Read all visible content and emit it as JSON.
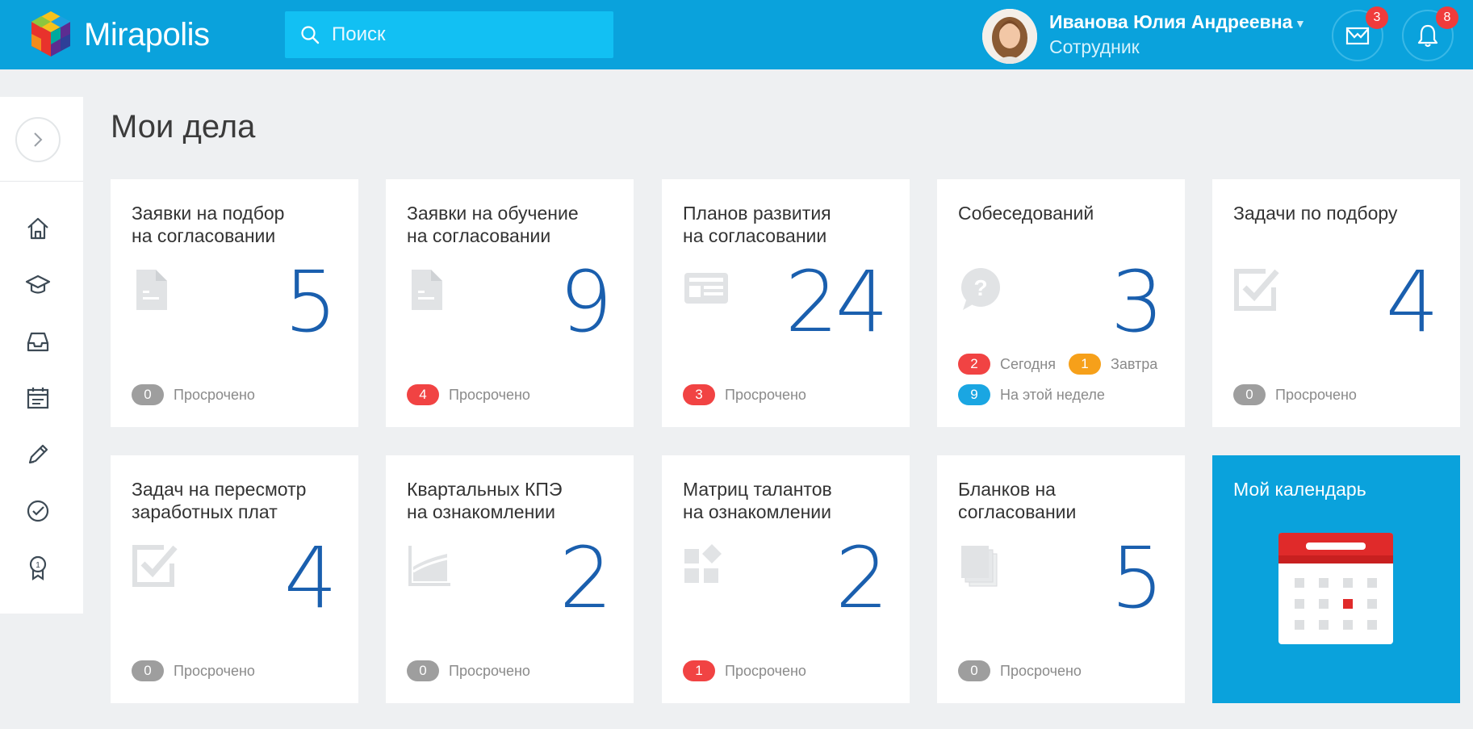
{
  "app": {
    "name": "Mirapolis"
  },
  "search": {
    "placeholder": "Поиск"
  },
  "user": {
    "name": "Иванова Юлия Андреевна",
    "role": "Сотрудник"
  },
  "header_buttons": {
    "messages_count": "3",
    "notifications_count": "8"
  },
  "sidebar": {
    "items": [
      {
        "icon": "home-icon"
      },
      {
        "icon": "graduation-cap-icon"
      },
      {
        "icon": "inbox-icon"
      },
      {
        "icon": "calendar-icon"
      },
      {
        "icon": "pencil-icon"
      },
      {
        "icon": "check-circle-icon"
      },
      {
        "icon": "award-icon"
      }
    ]
  },
  "page": {
    "title": "Мои дела"
  },
  "cards": [
    {
      "title_line1": "Заявки на подбор",
      "title_line2": "на согласовании",
      "count": "5",
      "overdue_count": "0",
      "overdue_label": "Просрочено",
      "icon": "document-icon"
    },
    {
      "title_line1": "Заявки на обучение",
      "title_line2": "на согласовании",
      "count": "9",
      "overdue_count": "4",
      "overdue_label": "Просрочено",
      "icon": "document-icon"
    },
    {
      "title_line1": "Планов развития",
      "title_line2": "на согласовании",
      "count": "24",
      "overdue_count": "3",
      "overdue_label": "Просрочено",
      "icon": "newspaper-icon"
    },
    {
      "title_line1": "Собеседований",
      "title_line2": "",
      "count": "3",
      "icon": "question-bubble-icon",
      "stats": {
        "today_count": "2",
        "today_label": "Сегодня",
        "tomorrow_count": "1",
        "tomorrow_label": "Завтра",
        "week_count": "9",
        "week_label": "На этой неделе"
      }
    },
    {
      "title_line1": "Задачи по подбору",
      "title_line2": "",
      "count": "4",
      "overdue_count": "0",
      "overdue_label": "Просрочено",
      "icon": "checkbox-icon"
    },
    {
      "title_line1": "Задач на пересмотр",
      "title_line2": "заработных плат",
      "count": "4",
      "overdue_count": "0",
      "overdue_label": "Просрочено",
      "icon": "checkbox-icon"
    },
    {
      "title_line1": "Квартальных КПЭ",
      "title_line2": "на ознакомлении",
      "count": "2",
      "overdue_count": "0",
      "overdue_label": "Просрочено",
      "icon": "area-chart-icon"
    },
    {
      "title_line1": "Матриц талантов",
      "title_line2": "на ознакомлении",
      "count": "2",
      "overdue_count": "1",
      "overdue_label": "Просрочено",
      "icon": "grid-diamond-icon"
    },
    {
      "title_line1": "Бланков на",
      "title_line2": "согласовании",
      "count": "5",
      "overdue_count": "0",
      "overdue_label": "Просрочено",
      "icon": "pages-stack-icon"
    },
    {
      "title_line1": "Мой календарь",
      "icon": "calendar-big-icon"
    }
  ],
  "colors": {
    "header": "#0aa2dc",
    "number": "#1a5fae",
    "red": "#f14343",
    "orange": "#f6a01a",
    "blue": "#1aa6e2",
    "grey": "#9e9e9e"
  }
}
